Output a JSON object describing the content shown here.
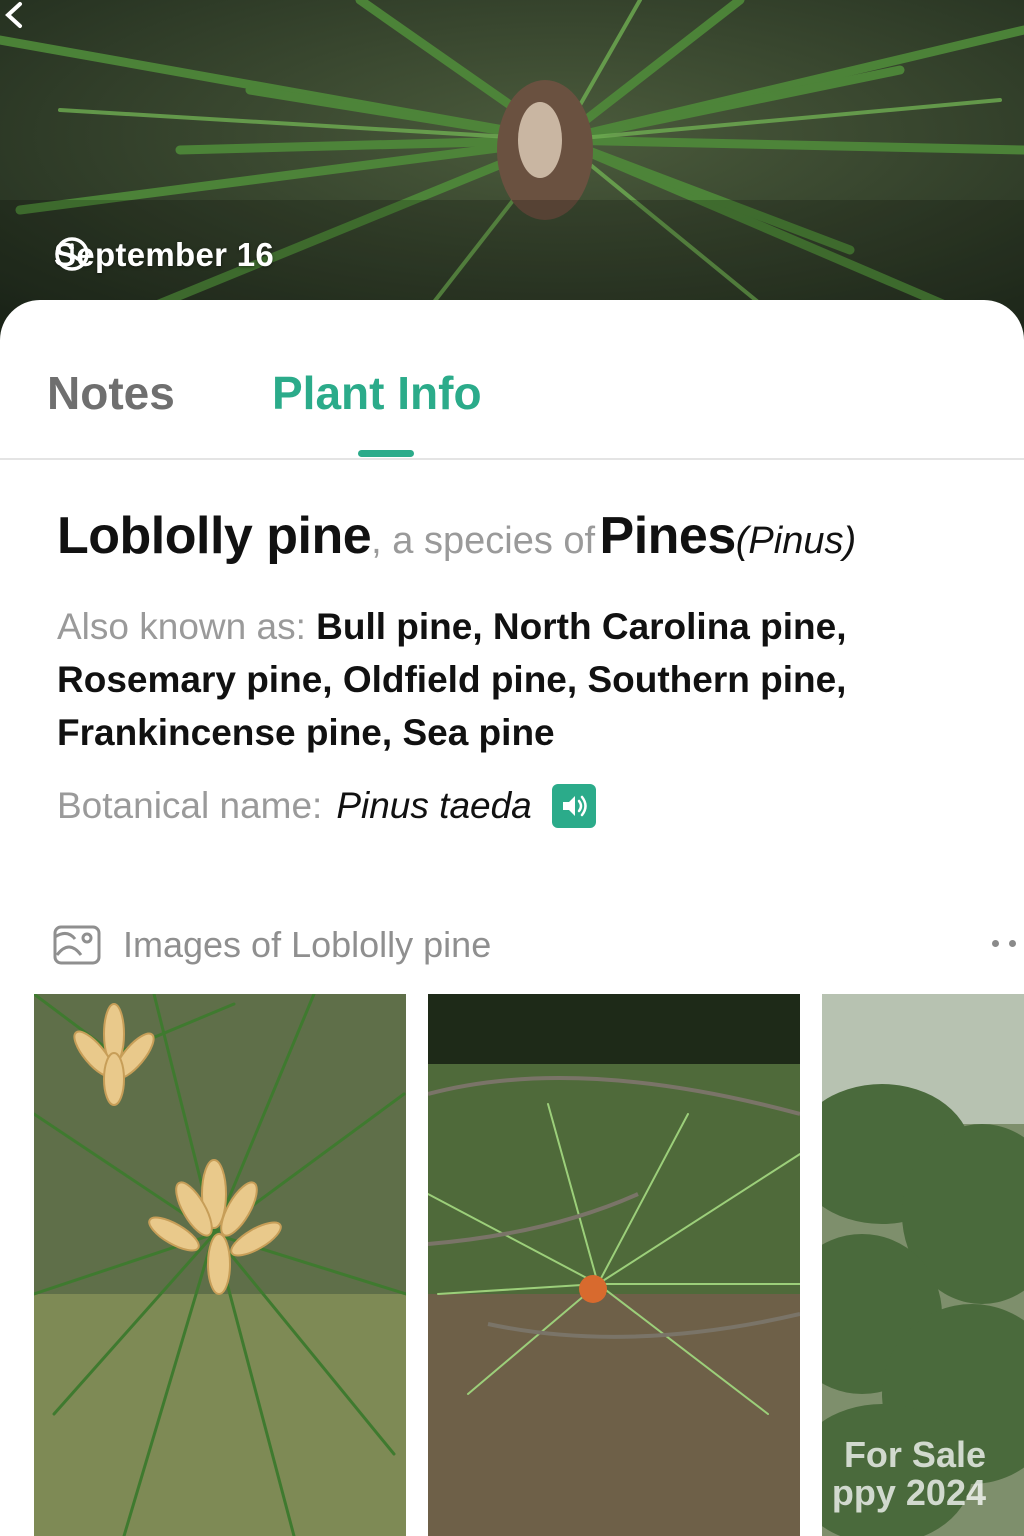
{
  "hero": {
    "date": "September 16",
    "clock_icon": "clock-icon",
    "back_icon": "chevron-left-icon"
  },
  "tabs": [
    {
      "label": "Notes",
      "active": false
    },
    {
      "label": "Plant Info",
      "active": true
    }
  ],
  "plant": {
    "common_name": "Loblolly pine",
    "species_of_text": ", a species of",
    "genus_common": "Pines",
    "genus_latin": "(Pinus)",
    "aka_label": "Also known as:",
    "aka_values": "Bull pine, North Carolina pine, Rosemary pine, Oldfield pine, Southern pine, Frankincense pine, Sea pine",
    "botanical_label": "Botanical name:",
    "botanical_value": "Pinus taeda"
  },
  "images_section": {
    "label": "Images of Loblolly pine",
    "icon": "image-gallery-icon"
  },
  "watermark": {
    "line1": "For Sale",
    "line2": "ppy 2024"
  },
  "colors": {
    "accent": "#2bab8a",
    "text": "#111111",
    "muted": "#9a9a9a"
  }
}
